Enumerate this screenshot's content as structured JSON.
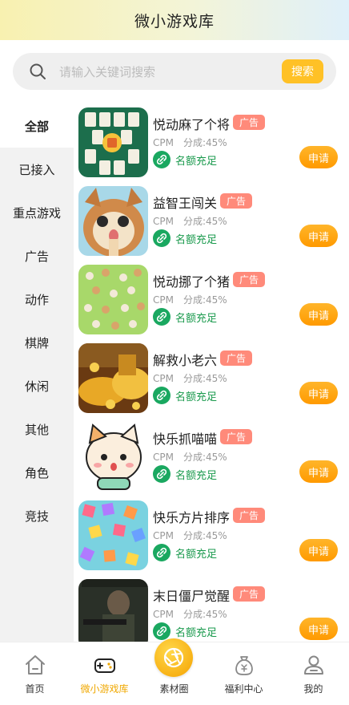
{
  "header": {
    "title": "微小游戏库"
  },
  "search": {
    "placeholder": "请输入关键词搜索",
    "button_label": "搜索"
  },
  "sidebar": {
    "items": [
      {
        "label": "全部",
        "active": true
      },
      {
        "label": "已接入"
      },
      {
        "label": "重点游戏"
      },
      {
        "label": "广告"
      },
      {
        "label": "动作"
      },
      {
        "label": "棋牌"
      },
      {
        "label": "休闲"
      },
      {
        "label": "其他"
      },
      {
        "label": "角色"
      },
      {
        "label": "竞技"
      }
    ]
  },
  "games": [
    {
      "name": "悦动麻了个将",
      "badge": "广告",
      "cpm": "CPM",
      "share": "分成:45%",
      "quota": "名额充足",
      "apply": "申请"
    },
    {
      "name": "益智王闯关",
      "badge": "广告",
      "cpm": "CPM",
      "share": "分成:45%",
      "quota": "名额充足",
      "apply": "申请"
    },
    {
      "name": "悦动挪了个猪",
      "badge": "广告",
      "cpm": "CPM",
      "share": "分成:45%",
      "quota": "名额充足",
      "apply": "申请"
    },
    {
      "name": "解救小老六",
      "badge": "广告",
      "cpm": "CPM",
      "share": "分成:45%",
      "quota": "名额充足",
      "apply": "申请"
    },
    {
      "name": "快乐抓喵喵",
      "badge": "广告",
      "cpm": "CPM",
      "share": "分成:45%",
      "quota": "名额充足",
      "apply": "申请"
    },
    {
      "name": "快乐方片排序",
      "badge": "广告",
      "cpm": "CPM",
      "share": "分成:45%",
      "quota": "名额充足",
      "apply": "申请"
    },
    {
      "name": "末日僵尸觉醒",
      "badge": "广告",
      "cpm": "CPM",
      "share": "分成:45%",
      "quota": "名额充足",
      "apply": "申请"
    }
  ],
  "bottom_nav": {
    "items": [
      {
        "label": "首页",
        "icon": "home-icon"
      },
      {
        "label": "微小游戏库",
        "icon": "gamepad-icon",
        "active": true
      },
      {
        "label": "素材圈",
        "icon": "aperture-icon"
      },
      {
        "label": "福利中心",
        "icon": "money-bag-icon"
      },
      {
        "label": "我的",
        "icon": "user-icon"
      }
    ]
  },
  "colors": {
    "accent": "#ffc126",
    "apply_button": "#ff9a00",
    "badge": "#ff8a7a",
    "quota_green": "#1aa860",
    "active_nav": "#f0a800"
  }
}
